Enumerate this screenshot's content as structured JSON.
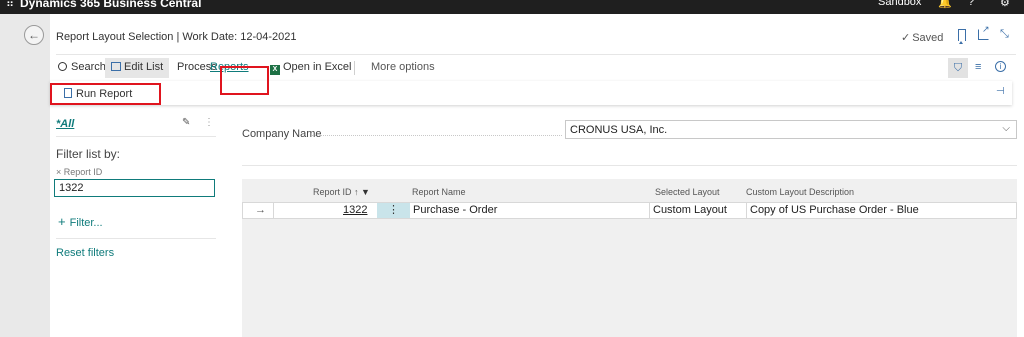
{
  "appbar": {
    "waffle": "⠿",
    "title": "Dynamics 365 Business Central",
    "environment": "Sandbox",
    "bell": "🔔",
    "help": "?",
    "gear": "⚙"
  },
  "page": {
    "back_arrow": "←",
    "title": "Report Layout Selection | Work Date: 12-04-2021",
    "saved_check": "✓",
    "saved": "Saved"
  },
  "actions": {
    "search": "Search",
    "edit_list": "Edit List",
    "process": "Process",
    "reports": "Reports",
    "excel_icon": "X",
    "open_in_excel": "Open in Excel",
    "more_options": "More options",
    "filter_icon": "⛉",
    "list_icon": "≡",
    "info_icon": "i"
  },
  "submenu": {
    "run_report": "Run Report",
    "pin_icon": "⊣"
  },
  "filter_pane": {
    "view": "*All",
    "edit_icon": "✎",
    "more_icon": "⋮",
    "filter_list_by": "Filter list by:",
    "field_tag": "× Report ID",
    "field_value": "1322",
    "plus": "+",
    "add_filter": "Filter...",
    "reset_filters": "Reset filters"
  },
  "company": {
    "label": "Company Name",
    "value": "CRONUS USA, Inc.",
    "chevron": "⌵"
  },
  "table": {
    "headers": {
      "report_id": "Report ID",
      "sort_arrow": "↑",
      "funnel": "▼",
      "report_name": "Report Name",
      "selected_layout": "Selected Layout",
      "custom_layout_description": "Custom Layout Description"
    },
    "rows": [
      {
        "arrow": "→",
        "report_id": "1322",
        "dots": "⋮",
        "report_name": "Purchase - Order",
        "selected_layout": "Custom Layout",
        "custom_layout_description": "Copy of US Purchase Order - Blue"
      }
    ]
  },
  "colors": {
    "accent": "#0f7b7b",
    "highlight_red": "#e0141e",
    "appbar": "#1f1f1f",
    "icon_blue": "#3b6fa8"
  }
}
